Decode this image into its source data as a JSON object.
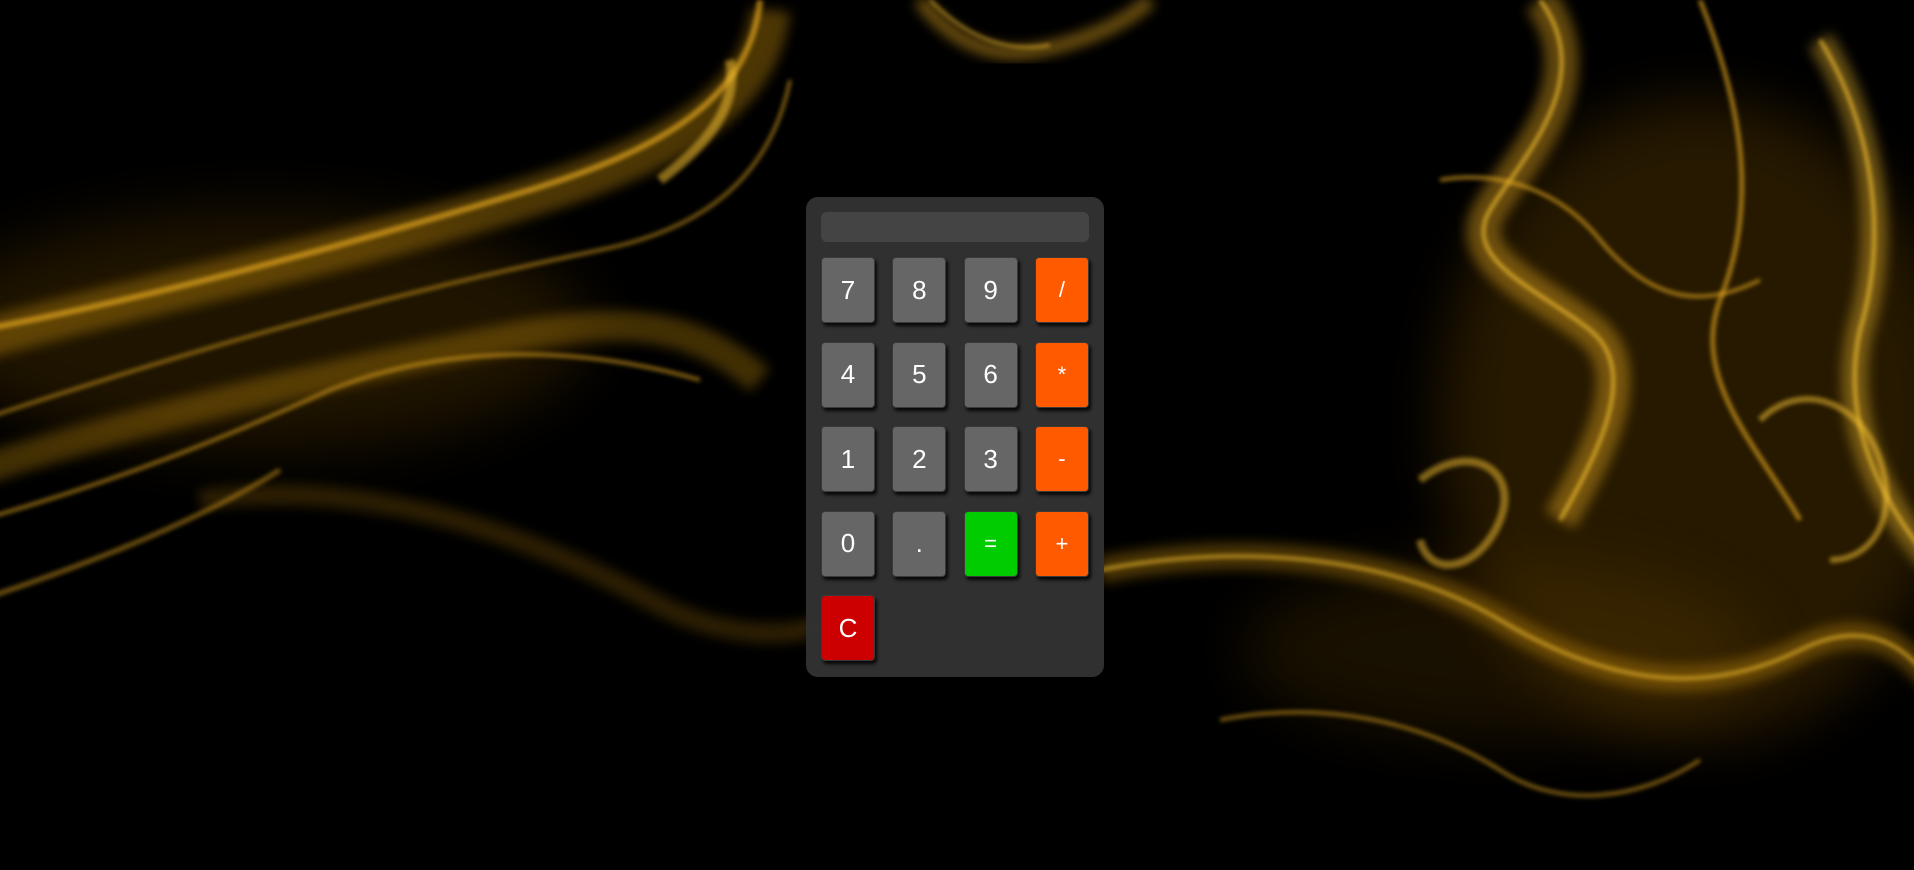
{
  "theme": {
    "background": "#000000",
    "smoke_color": "#f5b21b",
    "calculator_bg": "#323232",
    "display_bg": "#444444",
    "digit_key_color": "#666666",
    "operator_key_color": "#ff5a00",
    "equals_key_color": "#00cc00",
    "clear_key_color": "#cc0000"
  },
  "display": {
    "value": ""
  },
  "keys": [
    {
      "label": "7",
      "name": "key-7",
      "kind": "digit"
    },
    {
      "label": "8",
      "name": "key-8",
      "kind": "digit"
    },
    {
      "label": "9",
      "name": "key-9",
      "kind": "digit"
    },
    {
      "label": "/",
      "name": "key-divide",
      "kind": "operator"
    },
    {
      "label": "4",
      "name": "key-4",
      "kind": "digit"
    },
    {
      "label": "5",
      "name": "key-5",
      "kind": "digit"
    },
    {
      "label": "6",
      "name": "key-6",
      "kind": "digit"
    },
    {
      "label": "*",
      "name": "key-multiply",
      "kind": "operator"
    },
    {
      "label": "1",
      "name": "key-1",
      "kind": "digit"
    },
    {
      "label": "2",
      "name": "key-2",
      "kind": "digit"
    },
    {
      "label": "3",
      "name": "key-3",
      "kind": "digit"
    },
    {
      "label": "-",
      "name": "key-subtract",
      "kind": "operator"
    },
    {
      "label": "0",
      "name": "key-0",
      "kind": "digit"
    },
    {
      "label": ".",
      "name": "key-decimal",
      "kind": "digit"
    },
    {
      "label": "=",
      "name": "key-equals",
      "kind": "equals"
    },
    {
      "label": "+",
      "name": "key-add",
      "kind": "operator"
    },
    {
      "label": "C",
      "name": "key-clear",
      "kind": "clear"
    }
  ]
}
